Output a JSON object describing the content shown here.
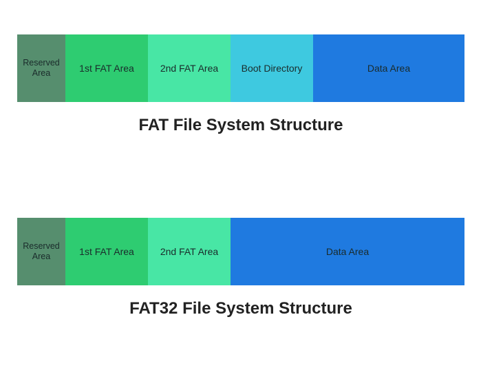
{
  "chart_data": [
    {
      "type": "bar",
      "title": "FAT File System Structure",
      "segments": [
        {
          "label": "Reserved Area",
          "weight": 70,
          "color": "#568e6e"
        },
        {
          "label": "1st FAT Area",
          "weight": 120,
          "color": "#2ecc71"
        },
        {
          "label": "2nd FAT Area",
          "weight": 120,
          "color": "#48e6a5"
        },
        {
          "label": "Boot Directory",
          "weight": 120,
          "color": "#3ec9e0"
        },
        {
          "label": "Data Area",
          "weight": 220,
          "color": "#1f7ae0"
        }
      ]
    },
    {
      "type": "bar",
      "title": "FAT32 File System Structure",
      "segments": [
        {
          "label": "Reserved Area",
          "weight": 70,
          "color": "#568e6e"
        },
        {
          "label": "1st FAT Area",
          "weight": 120,
          "color": "#2ecc71"
        },
        {
          "label": "2nd FAT Area",
          "weight": 120,
          "color": "#48e6a5"
        },
        {
          "label": "Data Area",
          "weight": 340,
          "color": "#1f7ae0"
        }
      ]
    }
  ]
}
